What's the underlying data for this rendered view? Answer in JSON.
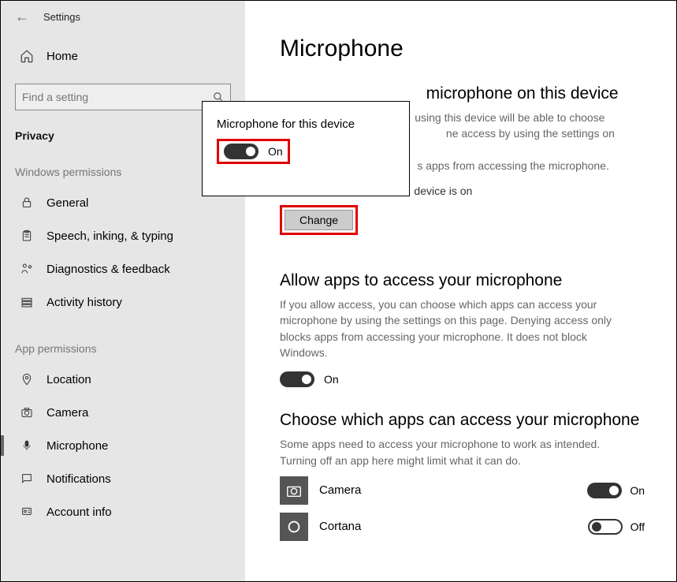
{
  "header": {
    "back": "←",
    "title": "Settings"
  },
  "sidebar": {
    "home": "Home",
    "searchPlaceholder": "Find a setting",
    "privacy": "Privacy",
    "winPermHead": "Windows permissions",
    "winPerms": [
      {
        "label": "General"
      },
      {
        "label": "Speech, inking, & typing"
      },
      {
        "label": "Diagnostics & feedback"
      },
      {
        "label": "Activity history"
      }
    ],
    "appPermHead": "App permissions",
    "appPerms": [
      {
        "label": "Location"
      },
      {
        "label": "Camera"
      },
      {
        "label": "Microphone"
      },
      {
        "label": "Notifications"
      },
      {
        "label": "Account info"
      }
    ]
  },
  "main": {
    "title": "Microphone",
    "sec1": {
      "titlePartial": "microphone on this device",
      "descPartial1": "using this device will be able to choose",
      "descPartial2": "ne access by using the settings on this",
      "descPartial3": "s apps from accessing the microphone.",
      "statusPartial": "device is on",
      "changeBtn": "Change"
    },
    "sec2": {
      "title": "Allow apps to access your microphone",
      "desc": "If you allow access, you can choose which apps can access your microphone by using the settings on this page. Denying access only blocks apps from accessing your microphone. It does not block Windows.",
      "toggleLabel": "On"
    },
    "sec3": {
      "title": "Choose which apps can access your microphone",
      "desc": "Some apps need to access your microphone to work as intended. Turning off an app here might limit what it can do.",
      "apps": [
        {
          "name": "Camera",
          "state": "On"
        },
        {
          "name": "Cortana",
          "state": "Off"
        }
      ]
    }
  },
  "popup": {
    "title": "Microphone for this device",
    "toggleLabel": "On"
  }
}
